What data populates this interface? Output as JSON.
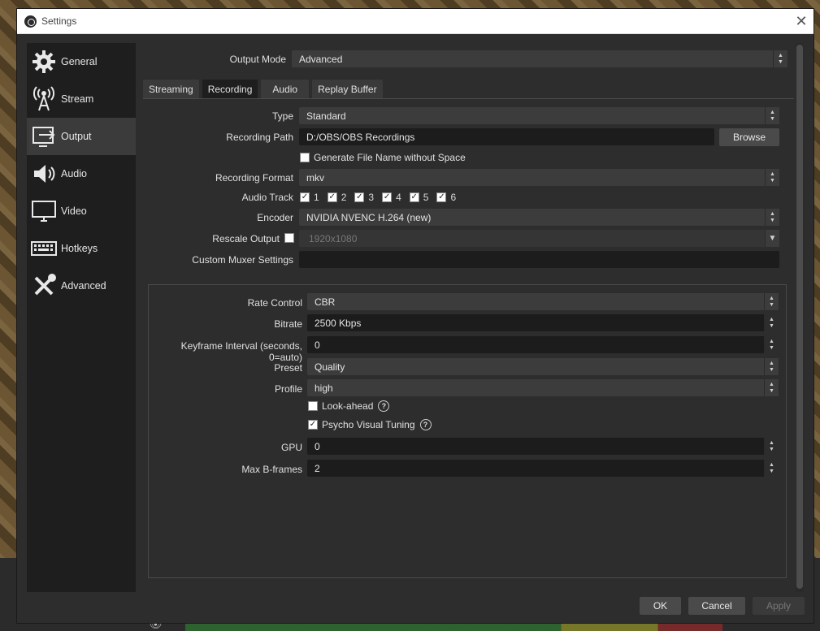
{
  "window": {
    "title": "Settings",
    "close_glyph": "✕"
  },
  "sidebar": {
    "items": [
      {
        "label": "General",
        "icon": "gear-icon"
      },
      {
        "label": "Stream",
        "icon": "broadcast-tower-icon"
      },
      {
        "label": "Output",
        "icon": "output-icon"
      },
      {
        "label": "Audio",
        "icon": "speaker-icon"
      },
      {
        "label": "Video",
        "icon": "monitor-icon"
      },
      {
        "label": "Hotkeys",
        "icon": "keyboard-icon"
      },
      {
        "label": "Advanced",
        "icon": "tools-icon"
      }
    ],
    "active": "Output"
  },
  "output_mode": {
    "label": "Output Mode",
    "value": "Advanced"
  },
  "tabs": [
    {
      "label": "Streaming"
    },
    {
      "label": "Recording"
    },
    {
      "label": "Audio"
    },
    {
      "label": "Replay Buffer"
    }
  ],
  "active_tab": "Recording",
  "recording": {
    "type": {
      "label": "Type",
      "value": "Standard"
    },
    "path": {
      "label": "Recording Path",
      "value": "D:/OBS/OBS Recordings",
      "browse": "Browse"
    },
    "no_space": {
      "label": "Generate File Name without Space",
      "checked": false
    },
    "format": {
      "label": "Recording Format",
      "value": "mkv"
    },
    "audio_track": {
      "label": "Audio Track",
      "tracks": [
        "1",
        "2",
        "3",
        "4",
        "5",
        "6"
      ]
    },
    "encoder": {
      "label": "Encoder",
      "value": "NVIDIA NVENC H.264 (new)"
    },
    "rescale": {
      "label": "Rescale Output",
      "value": "1920x1080",
      "checked": false
    },
    "muxer": {
      "label": "Custom Muxer Settings",
      "value": ""
    }
  },
  "encoder_settings": {
    "rate_control": {
      "label": "Rate Control",
      "value": "CBR"
    },
    "bitrate": {
      "label": "Bitrate",
      "value": "2500 Kbps"
    },
    "keyframe": {
      "label": "Keyframe Interval (seconds, 0=auto)",
      "value": "0"
    },
    "preset": {
      "label": "Preset",
      "value": "Quality"
    },
    "profile": {
      "label": "Profile",
      "value": "high"
    },
    "lookahead": {
      "label": "Look-ahead",
      "checked": false
    },
    "psycho": {
      "label": "Psycho Visual Tuning",
      "checked": true
    },
    "gpu": {
      "label": "GPU",
      "value": "0"
    },
    "bframes": {
      "label": "Max B-frames",
      "value": "2"
    }
  },
  "footer": {
    "ok": "OK",
    "cancel": "Cancel",
    "apply": "Apply"
  },
  "glyphs": {
    "check": "✓",
    "help": "?",
    "up": "▲",
    "down": "▼",
    "chevron": "⌄",
    "eye": "👁"
  }
}
